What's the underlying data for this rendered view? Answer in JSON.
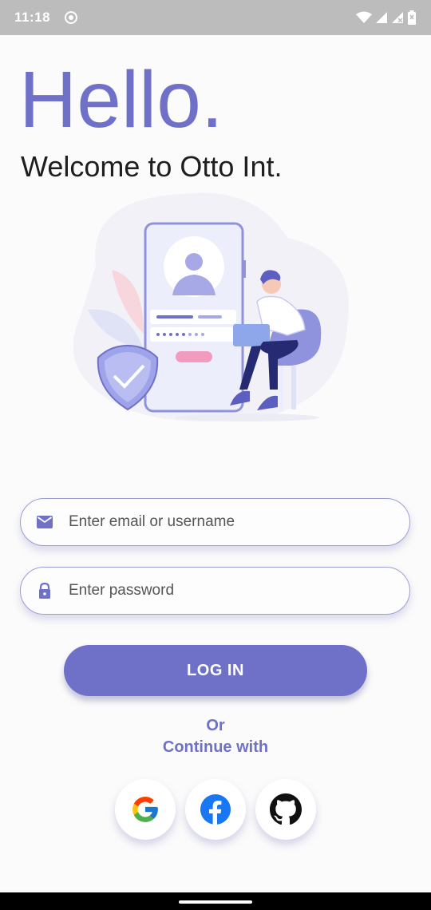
{
  "status_bar": {
    "time": "11:18",
    "icons": [
      "settings-dot-icon",
      "wifi-icon",
      "signal-icon",
      "signal-x-icon",
      "battery-icon"
    ]
  },
  "header": {
    "title": "Hello.",
    "subtitle": "Welcome to Otto Int."
  },
  "form": {
    "email_placeholder": "Enter email or username",
    "email_value": "",
    "password_placeholder": "Enter password",
    "password_value": "",
    "login_label": "LOG IN"
  },
  "social": {
    "or_label": "Or",
    "continue_label": "Continue with",
    "providers": [
      "google-icon",
      "facebook-icon",
      "github-icon"
    ]
  },
  "colors": {
    "accent": "#6f71c8",
    "status_bar": "#bcbcbc",
    "background": "#fbfbfb"
  }
}
